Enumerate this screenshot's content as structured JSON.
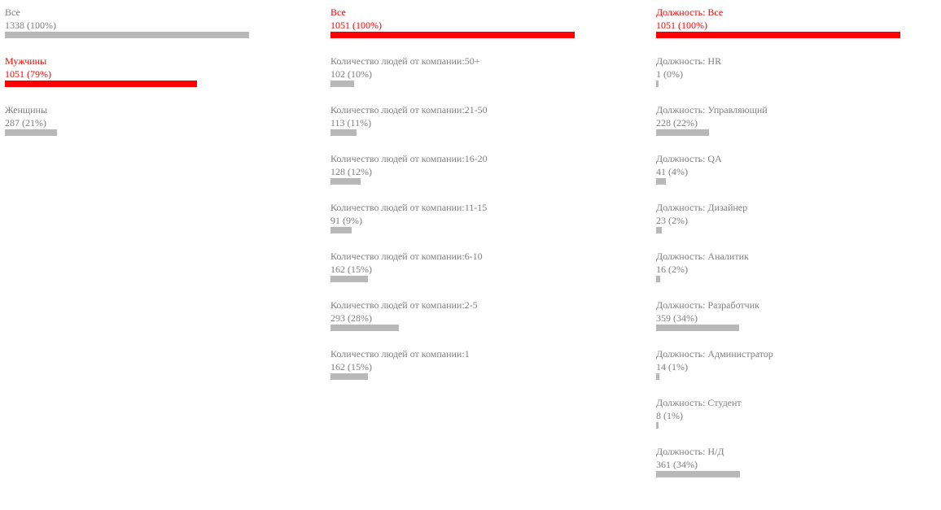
{
  "colors": {
    "text": "#808080",
    "bar": "#b8b8b8",
    "selected": "#ff0000"
  },
  "chart_data": [
    {
      "type": "bar",
      "orientation": "horizontal",
      "categories": [
        "Все",
        "Мужчины",
        "Женщины"
      ],
      "values": [
        1338,
        1051,
        287
      ],
      "labels": [
        "1338 (100%)",
        "1051 (79%)",
        "287 (21%)"
      ],
      "selected": [
        false,
        true,
        false
      ],
      "xlim": [
        0,
        1338
      ]
    },
    {
      "type": "bar",
      "orientation": "horizontal",
      "categories": [
        "Все",
        "Количество людей от компании:50+",
        "Количество людей от компании:21-50",
        "Количество людей от компании:16-20",
        "Количество людей от компании:11-15",
        "Количество людей от компании:6-10",
        "Количество людей от компании:2-5",
        "Количество людей от компании:1"
      ],
      "values": [
        1051,
        102,
        113,
        128,
        91,
        162,
        293,
        162
      ],
      "labels": [
        "1051 (100%)",
        "102 (10%)",
        "113 (11%)",
        "128 (12%)",
        "91 (9%)",
        "162 (15%)",
        "293 (28%)",
        "162 (15%)"
      ],
      "selected": [
        true,
        false,
        false,
        false,
        false,
        false,
        false,
        false
      ],
      "xlim": [
        0,
        1051
      ]
    },
    {
      "type": "bar",
      "orientation": "horizontal",
      "categories": [
        "Должность: Все",
        "Должность: HR",
        "Должность: Управляющий",
        "Должность: QA",
        "Должность: Дизайнер",
        "Должность: Аналитик",
        "Должность: Разработчик",
        "Должность: Администратор",
        "Должность: Студент",
        "Должность: Н/Д"
      ],
      "values": [
        1051,
        1,
        228,
        41,
        23,
        16,
        359,
        14,
        8,
        361
      ],
      "labels": [
        "1051 (100%)",
        "1 (0%)",
        "228 (22%)",
        "41 (4%)",
        "23 (2%)",
        "16 (2%)",
        "359 (34%)",
        "14 (1%)",
        "8 (1%)",
        "361 (34%)"
      ],
      "selected": [
        true,
        false,
        false,
        false,
        false,
        false,
        false,
        false,
        false,
        false
      ],
      "xlim": [
        0,
        1051
      ]
    }
  ]
}
